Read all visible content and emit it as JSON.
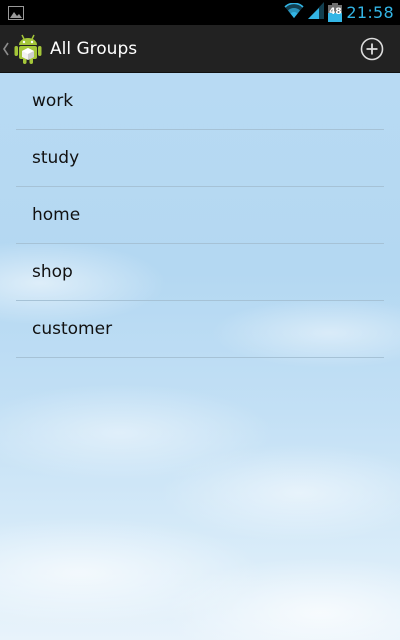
{
  "status_bar": {
    "time": "21:58",
    "battery_percent": "48",
    "notification_icon": "picture-icon",
    "wifi_icon": "wifi-icon",
    "signal_icon": "signal-icon",
    "battery_icon": "battery-icon",
    "accent_color": "#33b5e5"
  },
  "action_bar": {
    "title": "All Groups",
    "up_icon": "chevron-left-icon",
    "app_icon": "android-robot-icon",
    "action_icon": "add-circle-icon"
  },
  "groups": [
    {
      "label": "work"
    },
    {
      "label": "study"
    },
    {
      "label": "home"
    },
    {
      "label": "shop"
    },
    {
      "label": "customer"
    }
  ]
}
